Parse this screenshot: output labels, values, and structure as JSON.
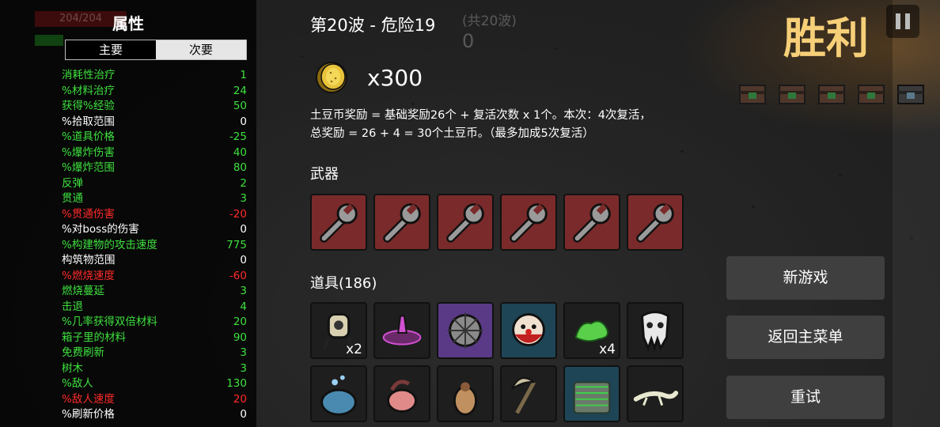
{
  "stats_panel": {
    "title": "属性",
    "hp_text": "204/204",
    "tabs": {
      "primary": "主要",
      "secondary": "次要"
    },
    "rows": [
      {
        "label": "消耗性治疗",
        "value": "1",
        "color": "green"
      },
      {
        "label": "%材料治疗",
        "value": "24",
        "color": "green"
      },
      {
        "label": "获得%经验",
        "value": "50",
        "color": "green"
      },
      {
        "label": "%拾取范围",
        "value": "0",
        "color": "white"
      },
      {
        "label": "%道具价格",
        "value": "-25",
        "color": "green"
      },
      {
        "label": "%爆炸伤害",
        "value": "40",
        "color": "green"
      },
      {
        "label": "%爆炸范围",
        "value": "80",
        "color": "green"
      },
      {
        "label": "反弹",
        "value": "2",
        "color": "green"
      },
      {
        "label": "贯通",
        "value": "3",
        "color": "green"
      },
      {
        "label": "%贯通伤害",
        "value": "-20",
        "color": "red"
      },
      {
        "label": "%对boss的伤害",
        "value": "0",
        "color": "white"
      },
      {
        "label": "%构建物的攻击速度",
        "value": "775",
        "color": "green"
      },
      {
        "label": "构筑物范围",
        "value": "0",
        "color": "white"
      },
      {
        "label": "%燃烧速度",
        "value": "-60",
        "color": "red"
      },
      {
        "label": "燃烧蔓延",
        "value": "3",
        "color": "green"
      },
      {
        "label": "击退",
        "value": "4",
        "color": "green"
      },
      {
        "label": "%几率获得双倍材料",
        "value": "20",
        "color": "green"
      },
      {
        "label": "箱子里的材料",
        "value": "90",
        "color": "green"
      },
      {
        "label": "免费刷新",
        "value": "3",
        "color": "green"
      },
      {
        "label": "树木",
        "value": "3",
        "color": "green"
      },
      {
        "label": "%敌人",
        "value": "130",
        "color": "green"
      },
      {
        "label": "%敌人速度",
        "value": "20",
        "color": "red"
      },
      {
        "label": "%刷新价格",
        "value": "0",
        "color": "white"
      }
    ]
  },
  "header": {
    "wave": "第20波 - 危险19",
    "wave_total": "(共20波)",
    "wave_counter": "0",
    "victory": "胜利"
  },
  "reward": {
    "coin_amount": "x300",
    "line1": "土豆币奖励 = 基础奖励26个 + 复活次数 x 1个。本次：4次复活，",
    "line2": "总奖励 = 26 + 4 = 30个土豆币。（最多加成5次复活）"
  },
  "weapons": {
    "label": "武器",
    "items": [
      "wrench-icon",
      "wrench-icon",
      "wrench-icon",
      "wrench-icon",
      "wrench-icon",
      "wrench-icon"
    ]
  },
  "items": {
    "label": "道具(186)",
    "row1": [
      {
        "icon": "turret-icon",
        "count": "x2",
        "tier": "normal"
      },
      {
        "icon": "pink-altar-icon",
        "count": "",
        "tier": "normal"
      },
      {
        "icon": "spiked-mine-icon",
        "count": "",
        "tier": "purple"
      },
      {
        "icon": "clown-face-icon",
        "count": "",
        "tier": "blue"
      },
      {
        "icon": "green-slime-icon",
        "count": "x4",
        "tier": "normal"
      },
      {
        "icon": "skull-mask-icon",
        "count": "",
        "tier": "normal"
      }
    ],
    "row2": [
      {
        "icon": "cauldron-icon",
        "tier": "normal"
      },
      {
        "icon": "pink-creature-icon",
        "tier": "normal"
      },
      {
        "icon": "potato-statue-icon",
        "tier": "normal"
      },
      {
        "icon": "scythe-icon",
        "tier": "normal"
      },
      {
        "icon": "green-coil-icon",
        "tier": "blue"
      },
      {
        "icon": "white-lizard-icon",
        "tier": "normal"
      }
    ]
  },
  "buttons": {
    "new_game": "新游戏",
    "main_menu": "返回主菜单",
    "retry": "重试"
  },
  "colors": {
    "victory": "#f6cf78",
    "stat_green": "#3ee03e",
    "stat_red": "#ff2a2a",
    "weapon_slot": "#7a2a2a",
    "button": "#3f3f3f"
  }
}
